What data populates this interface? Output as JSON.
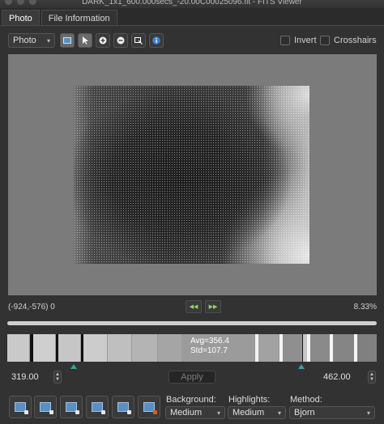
{
  "window": {
    "title": "DARK_1x1_600.000secs_-20.00C00025096.fit - FITS Viewer"
  },
  "tabs": [
    {
      "label": "Photo",
      "active": true
    },
    {
      "label": "File Information",
      "active": false
    }
  ],
  "toolbar": {
    "view_select": "Photo",
    "tools": [
      "image-icon",
      "pointer-icon",
      "zoom-in-icon",
      "zoom-out-icon",
      "fit-icon",
      "info-icon"
    ],
    "invert_label": "Invert",
    "crosshairs_label": "Crosshairs"
  },
  "status": {
    "coords": "(-924,-576) 0",
    "zoom": "8.33%"
  },
  "histogram": {
    "avg": "Avg=356.4",
    "std": "Std=107.7"
  },
  "levels": {
    "low": "319.00",
    "high": "462.00",
    "apply_label": "Apply"
  },
  "controls": {
    "background_label": "Background:",
    "background_value": "Medium",
    "highlights_label": "Highlights:",
    "highlights_value": "Medium",
    "method_label": "Method:",
    "method_value": "Bjorn"
  },
  "colors": {
    "panel": "#323232",
    "accent": "#3aa0a0",
    "nav_arrow": "#8fd36b"
  }
}
